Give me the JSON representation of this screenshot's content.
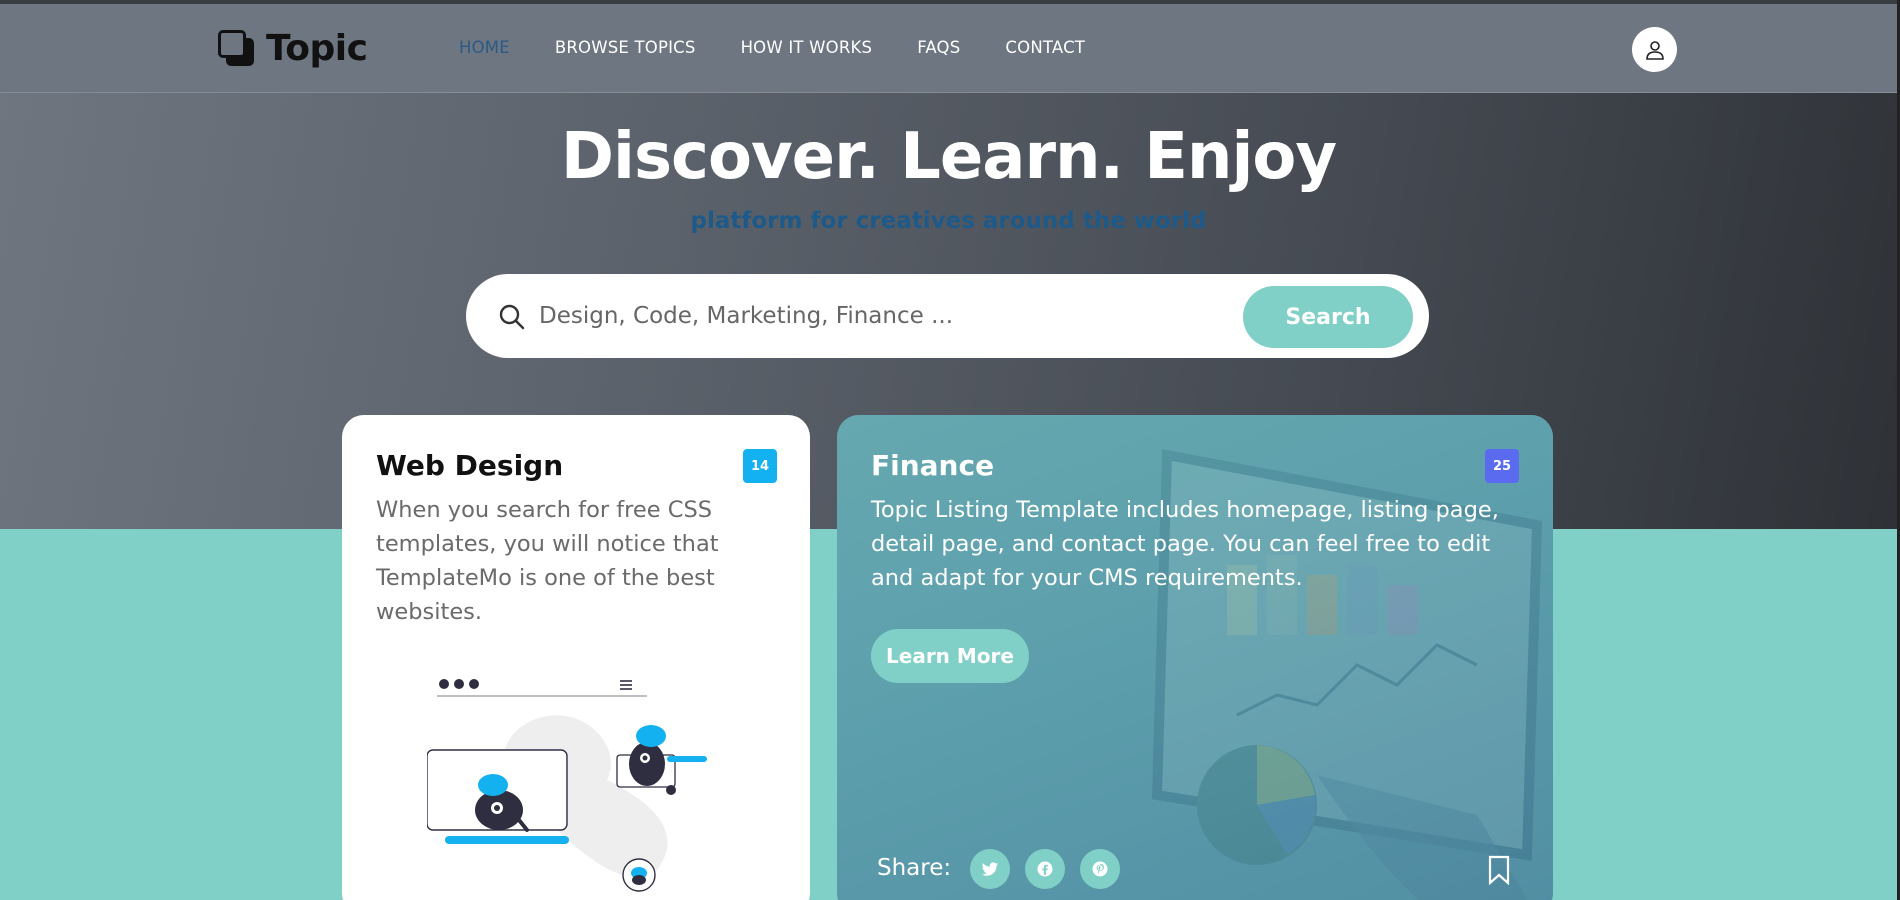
{
  "brand": {
    "name": "Topic",
    "logo_icon": "overlapping-squares-icon"
  },
  "nav": {
    "items": [
      {
        "label": "HOME",
        "active": true
      },
      {
        "label": "BROWSE TOPICS",
        "active": false
      },
      {
        "label": "HOW IT WORKS",
        "active": false
      },
      {
        "label": "FAQS",
        "active": false
      },
      {
        "label": "CONTACT",
        "active": false
      }
    ],
    "user_icon": "user-icon"
  },
  "hero": {
    "title": "Discover. Learn. Enjoy",
    "subtitle": "platform for creatives around the world"
  },
  "search": {
    "placeholder": "Design, Code, Marketing, Finance ...",
    "value": "",
    "button_label": "Search",
    "icon": "search-icon"
  },
  "cards": {
    "web_design": {
      "title": "Web Design",
      "badge": "14",
      "text": "When you search for free CSS templates, you will notice that TemplateMo is one of the best websites."
    },
    "finance": {
      "title": "Finance",
      "badge": "25",
      "text": "Topic Listing Template includes homepage, listing page, detail page, and contact page. You can feel free to edit and adapt for your CMS requirements.",
      "button_label": "Learn More",
      "share_label": "Share:",
      "share_icons": [
        "twitter-icon",
        "facebook-icon",
        "pinterest-icon"
      ],
      "bookmark_icon": "bookmark-icon"
    }
  },
  "colors": {
    "accent": "#80d0c7",
    "active_nav": "#2a5a85",
    "subtitle": "#1d5a8a",
    "badge_web": "#13b1ef",
    "badge_finance": "#5b6bf0"
  }
}
